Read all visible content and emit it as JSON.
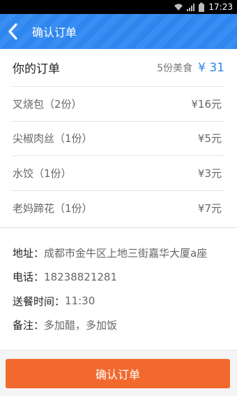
{
  "status_bar": {
    "time": "17:23"
  },
  "header": {
    "title": "确认订单",
    "back_icon": "chevron-left-icon"
  },
  "order": {
    "title": "你的订单",
    "count": "5份美食",
    "total": "¥ 31",
    "items": [
      {
        "name": "叉烧包（2份）",
        "price": "¥16元"
      },
      {
        "name": "尖椒肉丝（1份）",
        "price": "¥5元"
      },
      {
        "name": "水饺（1份）",
        "price": "¥3元"
      },
      {
        "name": "老妈蹄花（1份）",
        "price": "¥7元"
      }
    ]
  },
  "info": {
    "address": {
      "label": "地址",
      "value": "成都市金牛区上地三街嘉华大厦a座"
    },
    "phone": {
      "label": "电话",
      "value": "18238821281"
    },
    "delivery_time": {
      "label": "送餐时间",
      "value": "11:30"
    },
    "note": {
      "label": "备注",
      "value": "多加醋，多加饭"
    },
    "separator": "："
  },
  "footer": {
    "confirm_label": "确认订单"
  },
  "colors": {
    "header": "#2f86ee",
    "accent": "#2f86ee",
    "confirm_button": "#f2692e"
  }
}
